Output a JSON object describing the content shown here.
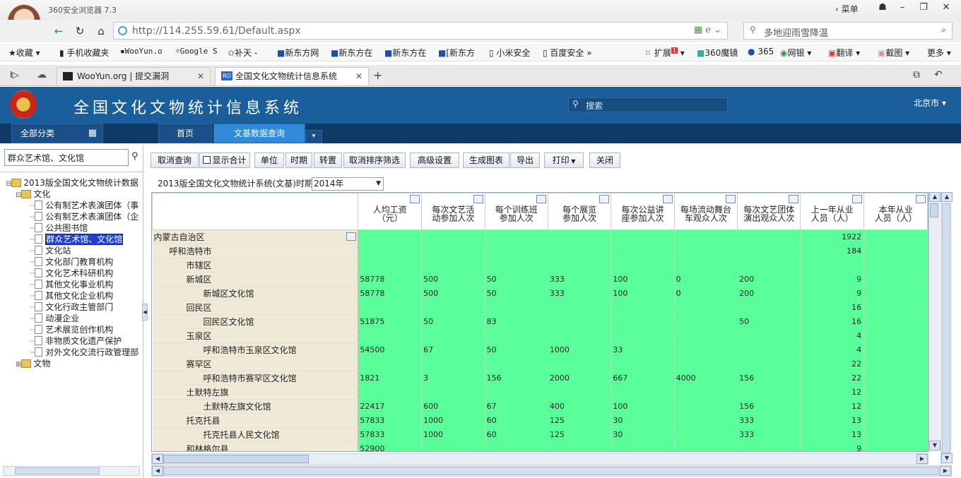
{
  "browser": {
    "app_title": "360安全浏览器 7.3",
    "menu": "菜单",
    "url": "http://114.255.59.61/Default.aspx",
    "search_placeholder": "多地迎雨雪降温",
    "bookmarks": [
      "收藏",
      "手机收藏夹",
      "WooYun.o",
      "Google S",
      "补天 -",
      "新东方网",
      "新东方在",
      "新东方在",
      "[新东方",
      "小米安全",
      "百度安全"
    ],
    "toolbar_items": [
      "扩展",
      "360魔镜",
      "365",
      "网银",
      "翻译",
      "截图",
      "更多"
    ],
    "ext_badge": "1",
    "tabs": [
      {
        "label": "WooYun.org | 提交漏洞"
      },
      {
        "label": "全国文化文物统计信息系统"
      }
    ]
  },
  "app": {
    "title": "全国文化文物统计信息系统",
    "search_label": "搜索",
    "region": "北京市",
    "nav": {
      "all_categories": "全部分类",
      "home": "首页",
      "query": "文基数据查询"
    }
  },
  "left": {
    "filter_value": "群众艺术馆、文化馆",
    "tree": [
      {
        "label": "2013版全国文化文物统计数据",
        "level": 0,
        "type": "folder"
      },
      {
        "label": "文化",
        "level": 1,
        "type": "folder"
      },
      {
        "label": "公有制艺术表演团体（事",
        "level": 2,
        "type": "doc"
      },
      {
        "label": "公有制艺术表演团体（企",
        "level": 2,
        "type": "doc"
      },
      {
        "label": "公共图书馆",
        "level": 2,
        "type": "doc"
      },
      {
        "label": "群众艺术馆、文化馆",
        "level": 2,
        "type": "doc",
        "selected": true
      },
      {
        "label": "文化站",
        "level": 2,
        "type": "doc"
      },
      {
        "label": "文化部门教育机构",
        "level": 2,
        "type": "doc"
      },
      {
        "label": "文化艺术科研机构",
        "level": 2,
        "type": "doc"
      },
      {
        "label": "其他文化事业机构",
        "level": 2,
        "type": "doc"
      },
      {
        "label": "其他文化企业机构",
        "level": 2,
        "type": "doc"
      },
      {
        "label": "文化行政主管部门",
        "level": 2,
        "type": "doc"
      },
      {
        "label": "动漫企业",
        "level": 2,
        "type": "doc"
      },
      {
        "label": "艺术展览创作机构",
        "level": 2,
        "type": "doc"
      },
      {
        "label": "非物质文化遗产保护",
        "level": 2,
        "type": "doc"
      },
      {
        "label": "对外文化交流行政管理部",
        "level": 2,
        "type": "doc"
      },
      {
        "label": "文物",
        "level": 1,
        "type": "folder"
      }
    ]
  },
  "toolbar": {
    "buttons": [
      "取消查询",
      "显示合计",
      "单位",
      "时期",
      "转置",
      "取消排序筛选",
      "高级设置",
      "生成图表",
      "导出",
      "打印",
      "关闭"
    ]
  },
  "filterbar": {
    "system_label": "2013版全国文化文物统计系统(文基)时期",
    "year": "2014年"
  },
  "grid": {
    "headers": [
      "人均工资\n（元）",
      "每次文艺活\n动参加人次",
      "每个训练班\n参加人次",
      "每个展览\n参加人次",
      "每次公益讲\n座参加人次",
      "每场流动舞台\n车观众人次",
      "每次文艺团体\n演出观众人次",
      "上一年从业\n人员（人）",
      "本年从业\n人员（人）"
    ],
    "rows": [
      {
        "name": "内蒙古自治区",
        "indent": 0,
        "v": [
          "",
          "",
          "",
          "",
          "",
          "",
          "",
          "1922",
          ""
        ]
      },
      {
        "name": "呼和浩特市",
        "indent": 1,
        "v": [
          "",
          "",
          "",
          "",
          "",
          "",
          "",
          "184",
          ""
        ]
      },
      {
        "name": "市辖区",
        "indent": 2,
        "v": [
          "",
          "",
          "",
          "",
          "",
          "",
          "",
          "",
          ""
        ]
      },
      {
        "name": "新城区",
        "indent": 2,
        "v": [
          "58778",
          "500",
          "50",
          "333",
          "100",
          "0",
          "200",
          "9",
          ""
        ]
      },
      {
        "name": "新城区文化馆",
        "indent": 3,
        "v": [
          "58778",
          "500",
          "50",
          "333",
          "100",
          "0",
          "200",
          "9",
          ""
        ]
      },
      {
        "name": "回民区",
        "indent": 2,
        "v": [
          "",
          "",
          "",
          "",
          "",
          "",
          "",
          "16",
          ""
        ]
      },
      {
        "name": "回民区文化馆",
        "indent": 3,
        "v": [
          "51875",
          "50",
          "83",
          "",
          "",
          "",
          "50",
          "16",
          ""
        ]
      },
      {
        "name": "玉泉区",
        "indent": 2,
        "v": [
          "",
          "",
          "",
          "",
          "",
          "",
          "",
          "4",
          ""
        ]
      },
      {
        "name": "呼和浩特市玉泉区文化馆",
        "indent": 3,
        "v": [
          "54500",
          "67",
          "50",
          "1000",
          "33",
          "",
          "",
          "4",
          ""
        ]
      },
      {
        "name": "赛罕区",
        "indent": 2,
        "v": [
          "",
          "",
          "",
          "",
          "",
          "",
          "",
          "22",
          ""
        ]
      },
      {
        "name": "呼和浩特市赛罕区文化馆",
        "indent": 3,
        "v": [
          "1821",
          "3",
          "156",
          "2000",
          "667",
          "4000",
          "156",
          "22",
          ""
        ]
      },
      {
        "name": "土默特左旗",
        "indent": 2,
        "v": [
          "",
          "",
          "",
          "",
          "",
          "",
          "",
          "12",
          ""
        ]
      },
      {
        "name": "土默特左旗文化馆",
        "indent": 3,
        "v": [
          "22417",
          "600",
          "67",
          "400",
          "100",
          "",
          "156",
          "12",
          ""
        ]
      },
      {
        "name": "托克托县",
        "indent": 2,
        "v": [
          "57833",
          "1000",
          "60",
          "125",
          "30",
          "",
          "333",
          "13",
          ""
        ]
      },
      {
        "name": "托克托县人民文化馆",
        "indent": 3,
        "v": [
          "57833",
          "1000",
          "60",
          "125",
          "30",
          "",
          "333",
          "13",
          ""
        ]
      },
      {
        "name": "和林格尔县",
        "indent": 2,
        "v": [
          "52900",
          "",
          "",
          "",
          "",
          "",
          "",
          "9",
          ""
        ]
      }
    ]
  }
}
